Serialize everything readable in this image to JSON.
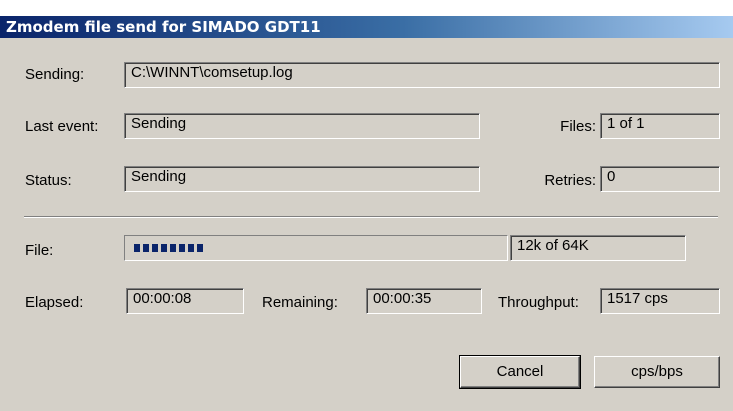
{
  "window": {
    "title": "Zmodem file send for SIMADO GDT11"
  },
  "sending": {
    "label": "Sending:",
    "value": "C:\\WINNT\\comsetup.log"
  },
  "last_event": {
    "label": "Last event:",
    "value": "Sending"
  },
  "files": {
    "label": "Files:",
    "value": "1 of 1"
  },
  "status": {
    "label": "Status:",
    "value": "Sending"
  },
  "retries": {
    "label": "Retries:",
    "value": "0"
  },
  "file": {
    "label": "File:",
    "progress_fraction": 0.19,
    "size_text": "12k of 64K"
  },
  "elapsed": {
    "label": "Elapsed:",
    "value": "00:00:08"
  },
  "remaining": {
    "label": "Remaining:",
    "value": "00:00:35"
  },
  "throughput": {
    "label": "Throughput:",
    "value": "1517 cps"
  },
  "buttons": {
    "cancel": "Cancel",
    "cps_bps": "cps/bps"
  },
  "colors": {
    "titlebar": "#0a246a",
    "face": "#d4d0c8",
    "progress": "#0a246a"
  }
}
